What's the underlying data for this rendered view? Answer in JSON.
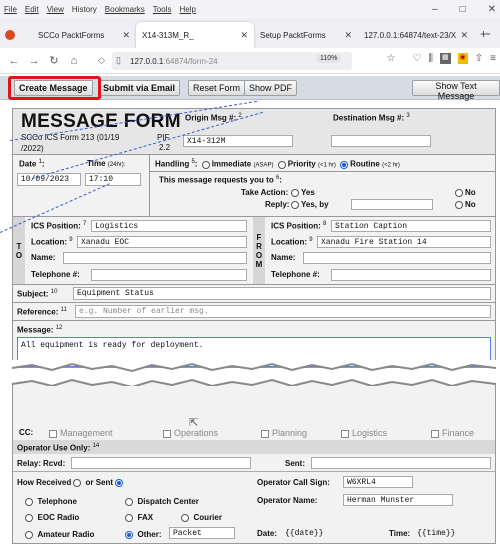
{
  "browser": {
    "menu": [
      "File",
      "Edit",
      "View",
      "History",
      "Bookmarks",
      "Tools",
      "Help"
    ],
    "tabs": [
      {
        "label": "SCCo PacktForms",
        "active": false
      },
      {
        "label": "X14-313M_R_",
        "active": true
      },
      {
        "label": "Setup PacktForms",
        "active": false
      },
      {
        "label": "127.0.0.1:64874/text-23/X",
        "active": false
      }
    ],
    "url_host": "127.0.0.1",
    "url_rest": ":64874/form-24",
    "zoom": "110%"
  },
  "toolbar": {
    "create_message": "Create Message",
    "submit_email": "Submit via Email",
    "reset_form": "Reset Form",
    "show_pdf": "Show PDF",
    "show_text": "Show Text Message"
  },
  "form": {
    "title": "MESSAGE FORM",
    "subtitle": "SCCo ICS Form 213 (01/19 /2022)",
    "pif_label": "PIF",
    "pif_value": "2.2",
    "origin_label": "Origin Msg #:",
    "origin_num": "2",
    "origin_value": "X14-312M",
    "dest_label": "Destination Msg #:",
    "dest_num": "3",
    "date_label": "Date",
    "date_num": "1",
    "date_value": "10/09/2023",
    "time_label": "Time",
    "time_hint": "(24hr):",
    "time_value": "17:10",
    "handling_label": "Handling",
    "handling_num": "5",
    "immediate": "Immediate",
    "immediate_hint": "(ASAP)",
    "priority": "Priority",
    "priority_hint": "(<1 hr)",
    "routine": "Routine",
    "routine_hint": "(<2 hr)",
    "requests_label": "This message requests you to",
    "requests_num": "6",
    "take_action": "Take Action:",
    "reply": "Reply:",
    "yes": "Yes",
    "yes_by": "Yes, by",
    "no": "No",
    "to_letters": "T O",
    "from_letters": "F R O M",
    "ics_position": "ICS Position:",
    "location": "Location:",
    "name": "Name:",
    "telephone": "Telephone #:",
    "to_pos_num": "7",
    "to_pos": "Logistics",
    "to_loc_num": "9",
    "to_loc": "Xanadu EOC",
    "from_pos_num": "8",
    "from_pos": "Station Caption",
    "from_loc_num": "9",
    "from_loc": "Xanadu Fire Station 14",
    "subject_label": "Subject:",
    "subject_num": "10",
    "subject_value": "Equipment Status",
    "reference_label": "Reference:",
    "reference_num": "11",
    "reference_placeholder": "e.g. Number of earlier msg.",
    "message_label": "Message:",
    "message_num": "12",
    "message_value": "All equipment is ready for deployment."
  },
  "bottom": {
    "cc_label": "CC:",
    "cc_options": [
      "Management",
      "Operations",
      "Planning",
      "Logistics",
      "Finance"
    ],
    "operator_use": "Operator Use Only:",
    "operator_num": "14",
    "relay": "Relay:",
    "rcvd": "Rcvd:",
    "sent": "Sent:",
    "how_received": "How Received",
    "or_sent": "or Sent",
    "operator_call_sign": "Operator Call Sign:",
    "call_sign_value": "W6XRL4",
    "operator_name": "Operator Name:",
    "operator_name_value": "Herman Munster",
    "telephone": "Telephone",
    "dispatch_center": "Dispatch Center",
    "eoc_radio": "EOC Radio",
    "fax": "FAX",
    "courier": "Courier",
    "amateur_radio": "Amateur Radio",
    "other": "Other:",
    "other_value": "Packet",
    "date_label": "Date:",
    "date_value": "{{date}}",
    "time_label": "Time:",
    "time_value": "{{time}}"
  },
  "colors": {
    "highlight": "#e0141b",
    "radio_on": "#1a56d6",
    "toolbar_bg": "#d7dce2"
  }
}
